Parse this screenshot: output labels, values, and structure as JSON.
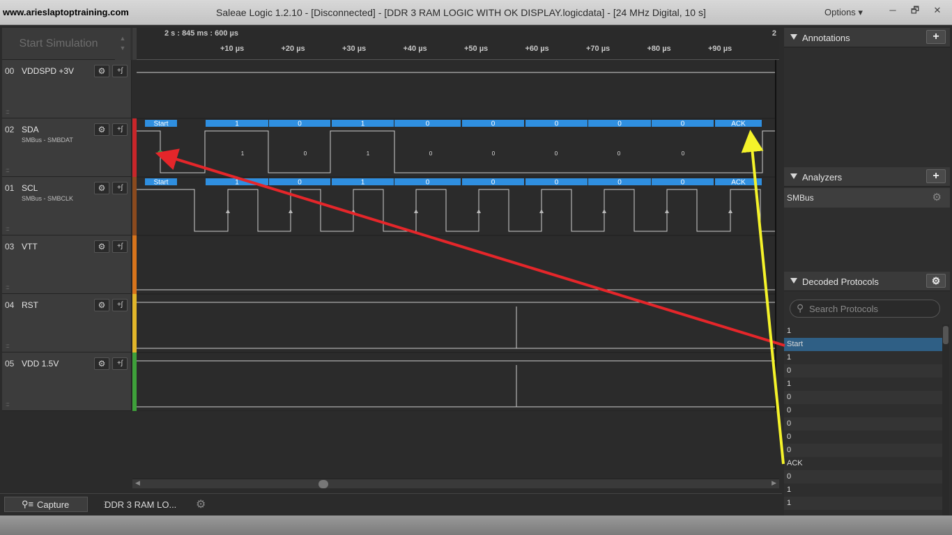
{
  "window": {
    "watermark": "www.arieslaptoptraining.com",
    "title": "Saleae Logic 1.2.10 - [Disconnected] - [DDR 3 RAM LOGIC WITH OK DISPLAY.logicdata] - [24 MHz Digital, 10 s]",
    "options_label": "Options ▾",
    "minimize": "─",
    "restore": "🗗",
    "close": "✕"
  },
  "simulation": {
    "label": "Start Simulation"
  },
  "ruler": {
    "timestamp": "2 s : 845 ms : 600 µs",
    "right_marker": "2",
    "ticks": [
      "+10 µs",
      "+20 µs",
      "+30 µs",
      "+40 µs",
      "+50 µs",
      "+60 µs",
      "+70 µs",
      "+80 µs",
      "+90 µs"
    ]
  },
  "channels": [
    {
      "num": "00",
      "name": "VDDSPD +3V",
      "sub": "",
      "color": "#2b2b2b"
    },
    {
      "num": "02",
      "name": "SDA",
      "sub": "SMBus - SMBDAT",
      "color": "#c8262a"
    },
    {
      "num": "01",
      "name": "SCL",
      "sub": "SMBus - SMBCLK",
      "color": "#8b4a1e"
    },
    {
      "num": "03",
      "name": "VTT",
      "sub": "",
      "color": "#d7741c"
    },
    {
      "num": "04",
      "name": "RST",
      "sub": "",
      "color": "#e1b62a"
    },
    {
      "num": "05",
      "name": "VDD 1.5V",
      "sub": "",
      "color": "#3ea03a"
    }
  ],
  "channel_buttons": {
    "settings": "⚙",
    "trigger": "+ʃ"
  },
  "decoded_labels": [
    "Start",
    "1",
    "0",
    "1",
    "0",
    "0",
    "0",
    "0",
    "0",
    "ACK"
  ],
  "sda_bit_values": [
    "1",
    "0",
    "1",
    "0",
    "0",
    "0",
    "0",
    "0"
  ],
  "tabs": {
    "capture": "Capture",
    "file": "DDR 3 RAM LO..."
  },
  "right_panel": {
    "annotations": {
      "title": "Annotations",
      "add": "+"
    },
    "analyzers": {
      "title": "Analyzers",
      "add": "+",
      "items": [
        "SMBus"
      ]
    },
    "decoded": {
      "title": "Decoded Protocols",
      "search_placeholder": "Search Protocols"
    },
    "decoded_list": [
      "1",
      "Start",
      "1",
      "0",
      "1",
      "0",
      "0",
      "0",
      "0",
      "0",
      "ACK",
      "0",
      "1",
      "1"
    ],
    "selected_index": 1
  },
  "colors": {
    "decode_blue": "#2f8fe0",
    "arrow_red": "#e5262a",
    "arrow_yellow": "#f4f22a",
    "selected_row": "#2f5f85"
  }
}
